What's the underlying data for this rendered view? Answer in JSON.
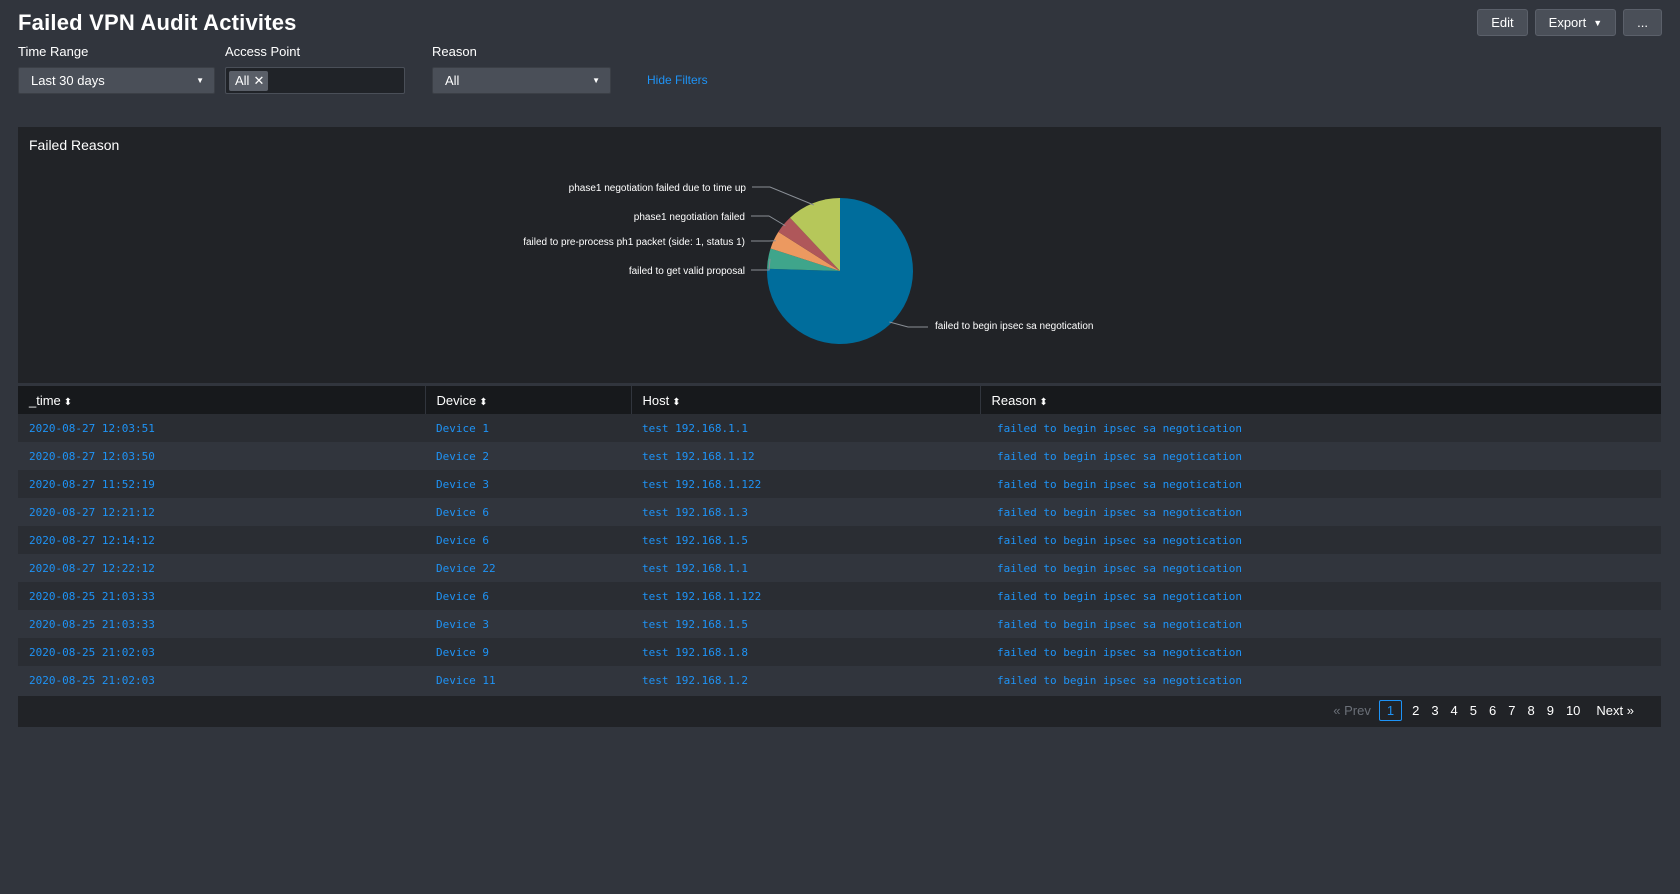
{
  "dashboard": {
    "title": "Failed VPN Audit Activites",
    "actions": {
      "edit": "Edit",
      "export": "Export",
      "more": "..."
    }
  },
  "filters": {
    "time_range": {
      "label": "Time Range",
      "value": "Last 30 days"
    },
    "access_point": {
      "label": "Access Point",
      "token": "All"
    },
    "reason": {
      "label": "Reason",
      "value": "All"
    },
    "hide_filters": "Hide Filters"
  },
  "panel": {
    "title": "Failed Reason"
  },
  "chart_data": {
    "type": "pie",
    "title": "Failed Reason",
    "slices": [
      {
        "label": "failed to begin ipsec sa negotication",
        "value": 75.5,
        "color": "#006d9c"
      },
      {
        "label": "failed to get valid proposal",
        "value": 4.5,
        "color": "#3fa58b"
      },
      {
        "label": "failed to pre-process ph1 packet (side: 1, status 1)",
        "value": 4.0,
        "color": "#ec9960"
      },
      {
        "label": "phase1 negotiation failed",
        "value": 4.0,
        "color": "#af575a"
      },
      {
        "label": "phase1 negotiation failed due to time up",
        "value": 12.0,
        "color": "#b6c75a"
      }
    ]
  },
  "table": {
    "columns": [
      "_time",
      "Device",
      "Host",
      "Reason"
    ],
    "sort_icon": "sort-icon",
    "rows": [
      [
        "2020-08-27 12:03:51",
        "Device 1",
        "test 192.168.1.1",
        "failed to begin ipsec sa negotication"
      ],
      [
        "2020-08-27 12:03:50",
        "Device 2",
        "test 192.168.1.12",
        "failed to begin ipsec sa negotication"
      ],
      [
        "2020-08-27 11:52:19",
        "Device 3",
        "test 192.168.1.122",
        "failed to begin ipsec sa negotication"
      ],
      [
        "2020-08-27 12:21:12",
        "Device 6",
        "test 192.168.1.3",
        "failed to begin ipsec sa negotication"
      ],
      [
        "2020-08-27 12:14:12",
        "Device 6",
        "test 192.168.1.5",
        "failed to begin ipsec sa negotication"
      ],
      [
        "2020-08-27 12:22:12",
        "Device 22",
        "test 192.168.1.1",
        "failed to begin ipsec sa negotication"
      ],
      [
        "2020-08-25 21:03:33",
        "Device 6",
        "test 192.168.1.122",
        "failed to begin ipsec sa negotication"
      ],
      [
        "2020-08-25 21:03:33",
        "Device 3",
        "test 192.168.1.5",
        "failed to begin ipsec sa negotication"
      ],
      [
        "2020-08-25 21:02:03",
        "Device 9",
        "test 192.168.1.8",
        "failed to begin ipsec sa negotication"
      ],
      [
        "2020-08-25 21:02:03",
        "Device 11",
        "test 192.168.1.2",
        "failed to begin ipsec sa negotication"
      ]
    ]
  },
  "pagination": {
    "prev": "« Prev",
    "current": "1",
    "pages": [
      "2",
      "3",
      "4",
      "5",
      "6",
      "7",
      "8",
      "9",
      "10"
    ],
    "next": "Next »"
  },
  "colors": {
    "link": "#1e93f6",
    "background": "#31353d",
    "panel": "#212327"
  }
}
